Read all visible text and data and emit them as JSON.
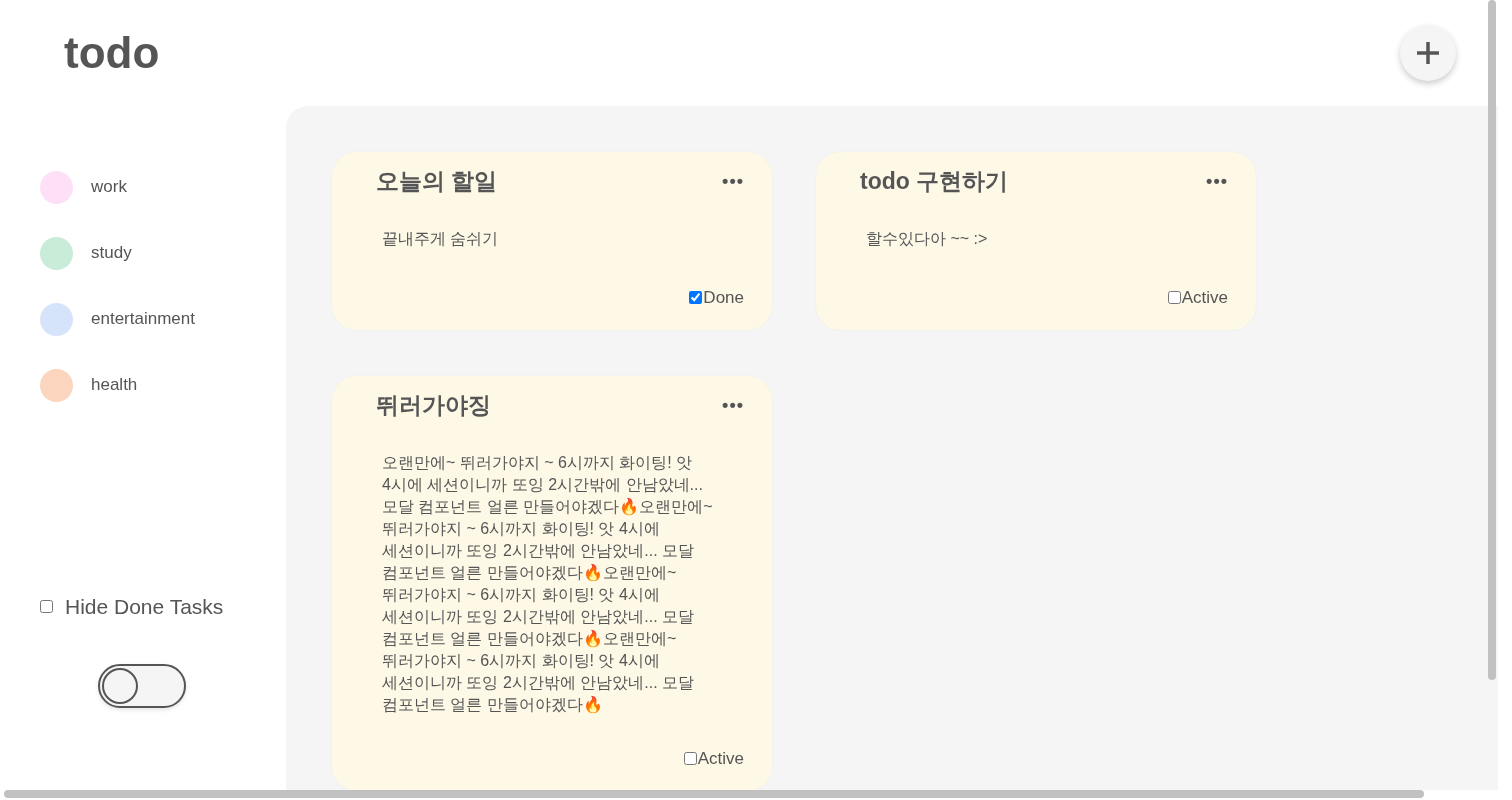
{
  "header": {
    "title": "todo"
  },
  "categories": [
    {
      "label": "work",
      "color": "#fde0f7"
    },
    {
      "label": "study",
      "color": "#c9ecd8"
    },
    {
      "label": "entertainment",
      "color": "#d6e4fb"
    },
    {
      "label": "health",
      "color": "#fbd5bd"
    }
  ],
  "hide_done": {
    "label": "Hide Done Tasks",
    "checked": false
  },
  "theme_toggle": {
    "on": false
  },
  "todos": [
    {
      "title": "오늘의 할일",
      "menu": "•••",
      "body": "끝내주게 숨쉬기",
      "status": "Done",
      "checked": true
    },
    {
      "title": "todo 구현하기",
      "menu": "•••",
      "body": "할수있다아 ~~ :>",
      "status": "Active",
      "checked": false
    },
    {
      "title": "뛰러가야징",
      "menu": "•••",
      "body": "오랜만에~ 뛰러가야지 ~ 6시까지 화이팅! 앗 4시에 세션이니까 또잉 2시간밖에 안남았네... 모달 컴포넌트 얼른 만들어야겠다🔥오랜만에~ 뛰러가야지 ~ 6시까지 화이팅! 앗 4시에 세션이니까 또잉 2시간밖에 안남았네... 모달 컴포넌트 얼른 만들어야겠다🔥오랜만에~ 뛰러가야지 ~ 6시까지 화이팅! 앗 4시에 세션이니까 또잉 2시간밖에 안남았네... 모달 컴포넌트 얼른 만들어야겠다🔥오랜만에~ 뛰러가야지 ~ 6시까지 화이팅! 앗 4시에 세션이니까 또잉 2시간밖에 안남았네... 모달 컴포넌트 얼른 만들어야겠다🔥",
      "status": "Active",
      "checked": false
    }
  ]
}
